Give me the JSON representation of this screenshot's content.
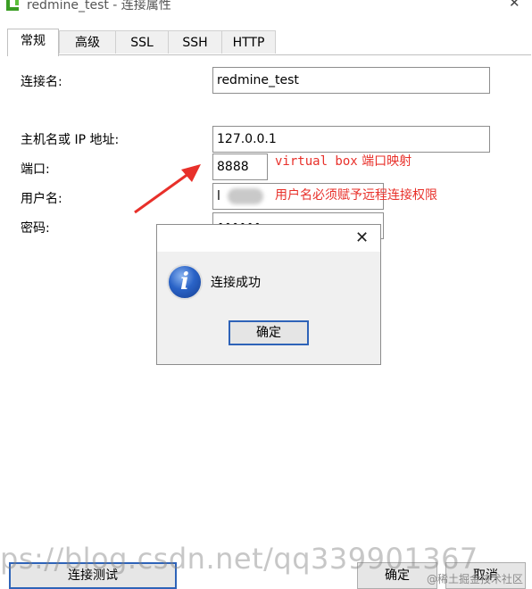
{
  "window": {
    "title": "redmine_test - 连接属性"
  },
  "tabs": [
    {
      "label": "常规"
    },
    {
      "label": "高级"
    },
    {
      "label": "SSL"
    },
    {
      "label": "SSH"
    },
    {
      "label": "HTTP"
    }
  ],
  "form": {
    "connection_name": {
      "label": "连接名:",
      "value": "redmine_test"
    },
    "host": {
      "label": "主机名或 IP 地址:",
      "value": "127.0.0.1"
    },
    "port": {
      "label": "端口:",
      "value": "8888"
    },
    "username": {
      "label": "用户名:",
      "value": "l"
    },
    "password": {
      "label": "密码:",
      "value": "••••••"
    }
  },
  "annotations": {
    "port_note_prefix": "virtual box",
    "port_note_suffix": "端口映射",
    "user_note": "用户名必须赋予远程连接权限",
    "arrow_color": "#e8302a"
  },
  "dialog": {
    "message": "连接成功",
    "ok_label": "确定",
    "icon": "info-icon"
  },
  "footer": {
    "test_label": "连接测试",
    "ok_label": "确定",
    "cancel_label": "取消"
  },
  "watermark": {
    "url": "ps://blog.csdn.net/qq339901367",
    "site": "@稀土掘金技术社区"
  }
}
